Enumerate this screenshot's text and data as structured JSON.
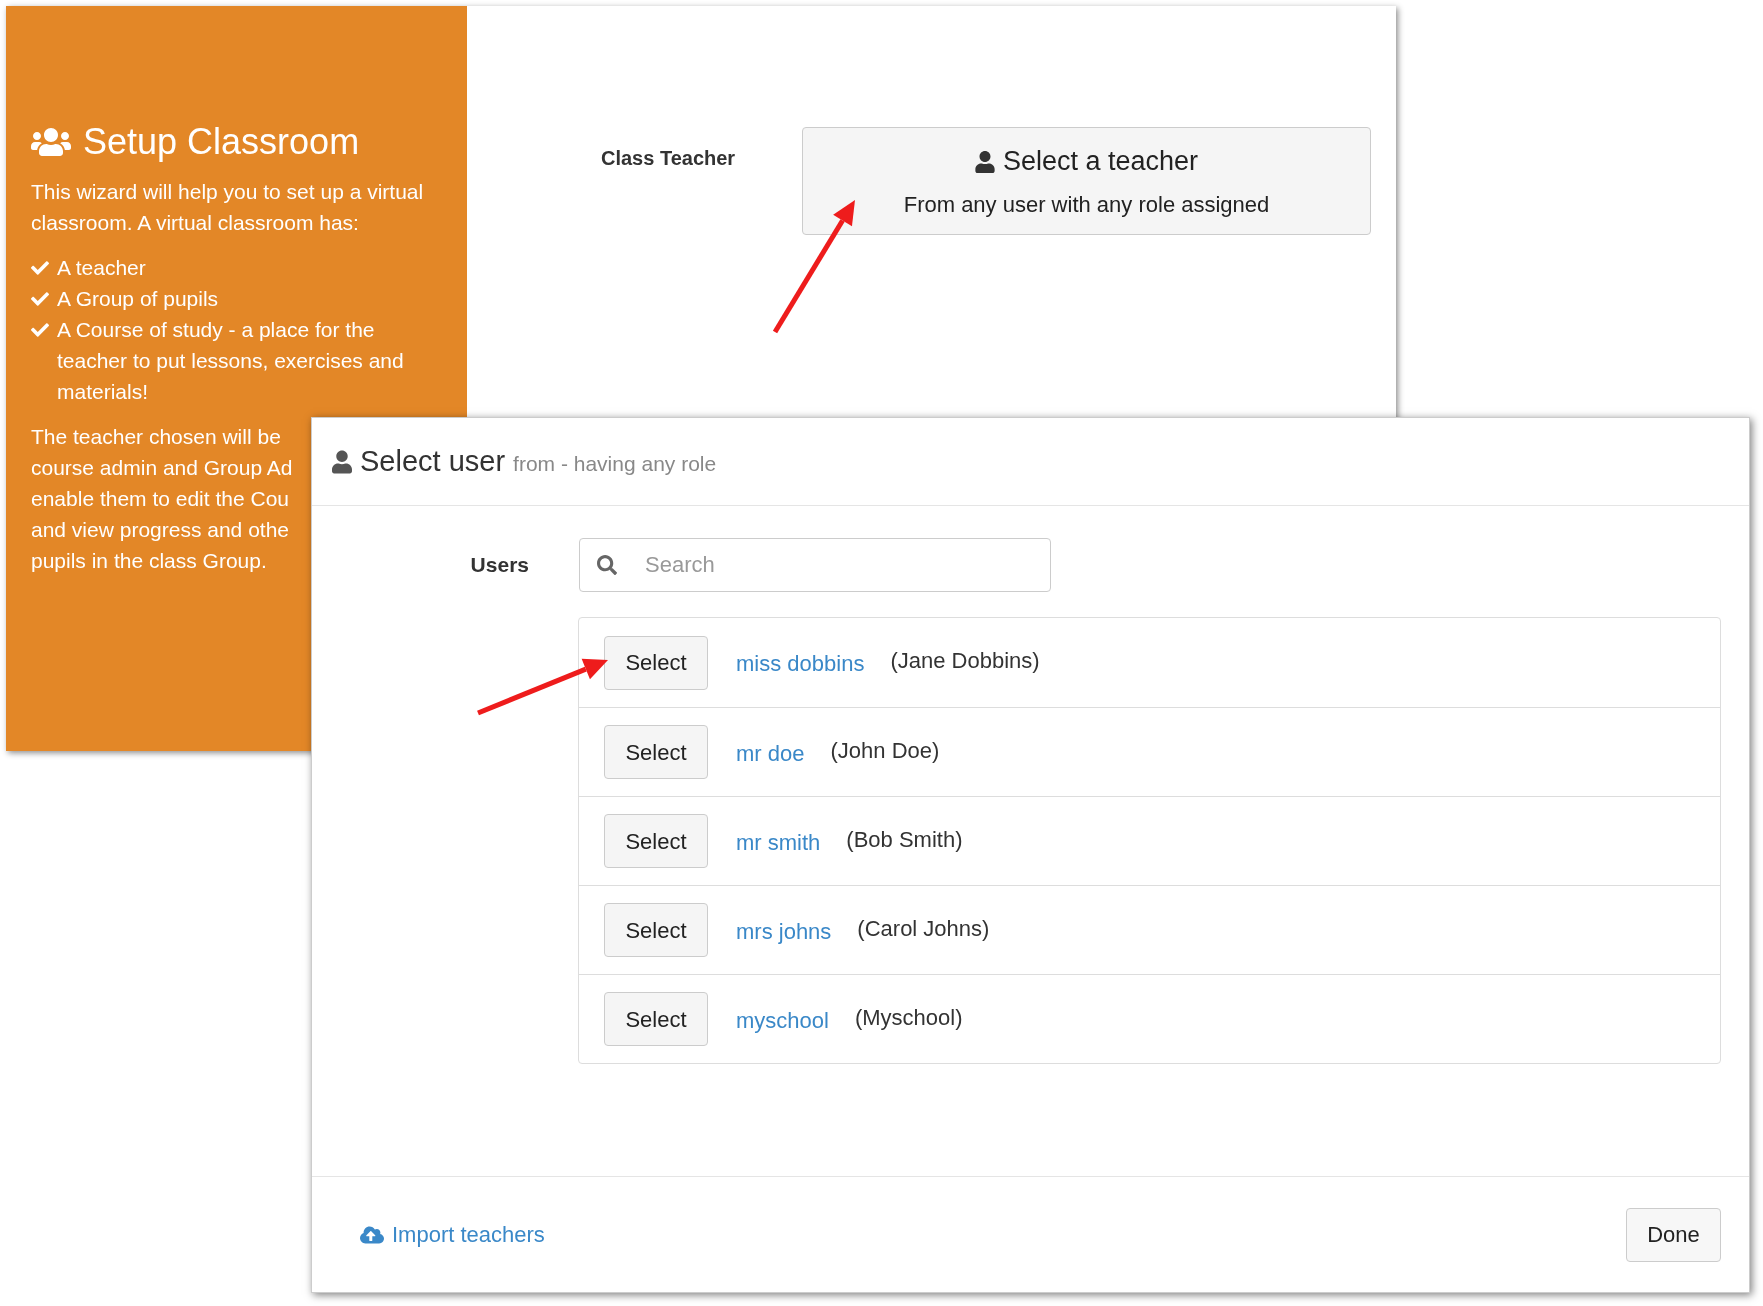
{
  "setup_panel": {
    "title": "Setup Classroom",
    "intro": "This wizard will help you to set up a virtual classroom. A virtual classroom has:",
    "checklist": [
      "A teacher",
      "A Group of pupils",
      "A Course of study - a place for the teacher to put lessons, exercises and materials!"
    ],
    "note_lines": [
      "The teacher chosen will be",
      "course admin and Group Ad",
      "enable them to edit the Cou",
      "and view progress and othe",
      "pupils in the class Group."
    ]
  },
  "class_teacher": {
    "label": "Class Teacher",
    "button_title": "Select a teacher",
    "button_subtitle": "From any user with any role assigned"
  },
  "dialog": {
    "title": "Select user",
    "subtitle": "from - having any role",
    "users_label": "Users",
    "search": {
      "placeholder": "Search"
    },
    "users": [
      {
        "button": "Select",
        "username": "miss dobbins",
        "full_name": "(Jane Dobbins)"
      },
      {
        "button": "Select",
        "username": "mr doe",
        "full_name": "(John Doe)"
      },
      {
        "button": "Select",
        "username": "mr smith",
        "full_name": "(Bob Smith)"
      },
      {
        "button": "Select",
        "username": "mrs johns",
        "full_name": "(Carol Johns)"
      },
      {
        "button": "Select",
        "username": "myschool",
        "full_name": "(Myschool)"
      }
    ],
    "import_link": "Import teachers",
    "done_button": "Done"
  }
}
